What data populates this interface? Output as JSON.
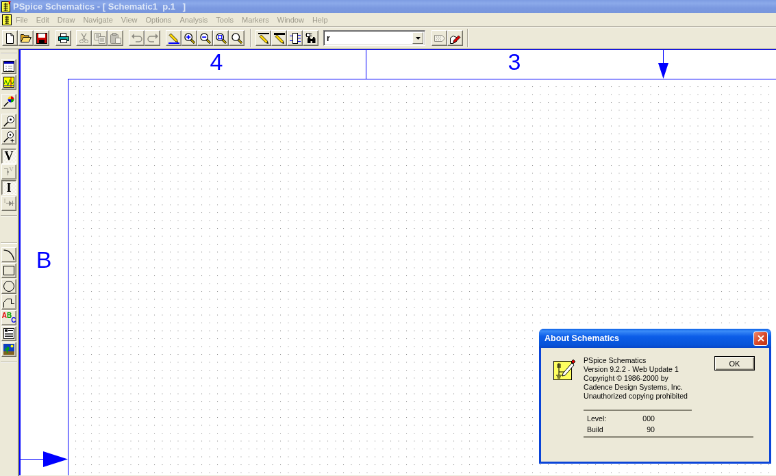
{
  "window": {
    "title": "PSpice Schematics - [ Schematic1  p.1   ]",
    "active": false
  },
  "menu": [
    {
      "label": "File",
      "disabled": true
    },
    {
      "label": "Edit",
      "disabled": true
    },
    {
      "label": "Draw",
      "disabled": true
    },
    {
      "label": "Navigate",
      "disabled": true
    },
    {
      "label": "View",
      "disabled": true
    },
    {
      "label": "Options",
      "disabled": true
    },
    {
      "label": "Analysis",
      "disabled": true
    },
    {
      "label": "Tools",
      "disabled": true
    },
    {
      "label": "Markers",
      "disabled": true
    },
    {
      "label": "Window",
      "disabled": true
    },
    {
      "label": "Help",
      "disabled": true
    }
  ],
  "toolbar": [
    {
      "kind": "button",
      "disabled": false
    },
    {
      "kind": "button",
      "disabled": false
    },
    {
      "kind": "button",
      "disabled": false
    },
    {
      "kind": "button",
      "disabled": false
    },
    {
      "kind": "button",
      "disabled": true
    },
    {
      "kind": "button",
      "disabled": true
    },
    {
      "kind": "button",
      "disabled": true
    },
    {
      "kind": "button",
      "disabled": true
    },
    {
      "kind": "button",
      "disabled": true
    },
    {
      "kind": "button",
      "disabled": false
    },
    {
      "kind": "button",
      "disabled": false
    },
    {
      "kind": "button",
      "disabled": false
    },
    {
      "kind": "button",
      "disabled": false
    },
    {
      "kind": "button",
      "disabled": false
    },
    {
      "kind": "button",
      "disabled": false
    },
    {
      "kind": "button",
      "disabled": false
    },
    {
      "kind": "button",
      "disabled": false
    },
    {
      "kind": "button",
      "disabled": false
    },
    {
      "kind": "combo",
      "value": "r"
    },
    {
      "kind": "button",
      "disabled": true
    },
    {
      "kind": "button",
      "disabled": false
    }
  ],
  "tool_palette": [
    {
      "pressed": false,
      "disabled": false
    },
    {
      "pressed": false,
      "disabled": false
    },
    {
      "pressed": false,
      "disabled": false
    },
    {
      "pressed": false,
      "disabled": false
    },
    {
      "pressed": false,
      "disabled": false
    },
    {
      "label": "V",
      "pressed": true,
      "disabled": false
    },
    {
      "label": "V",
      "pressed": false,
      "disabled": true
    },
    {
      "label": "I",
      "pressed": true,
      "disabled": false
    },
    {
      "label": "I",
      "pressed": false,
      "disabled": true
    },
    {
      "pressed": false,
      "disabled": false
    },
    {
      "pressed": false,
      "disabled": false
    },
    {
      "pressed": false,
      "disabled": false
    },
    {
      "pressed": false,
      "disabled": false
    },
    {
      "label": "ABC",
      "pressed": false,
      "disabled": false
    },
    {
      "pressed": false,
      "disabled": false
    },
    {
      "pressed": false,
      "disabled": false
    }
  ],
  "schematic": {
    "column_zones": [
      "4",
      "3"
    ],
    "row_zones": [
      "B"
    ]
  },
  "dialog": {
    "title": "About Schematics",
    "active": true,
    "lines": [
      "PSpice Schematics",
      "Version 9.2.2 - Web Update 1",
      "Copyright © 1986-2000 by",
      "Cadence Design Systems, Inc.",
      "Unauthorized copying prohibited"
    ],
    "info": [
      {
        "label": "Level:",
        "value": "000"
      },
      {
        "label": "Build",
        "value": "90"
      }
    ],
    "button": "OK"
  }
}
